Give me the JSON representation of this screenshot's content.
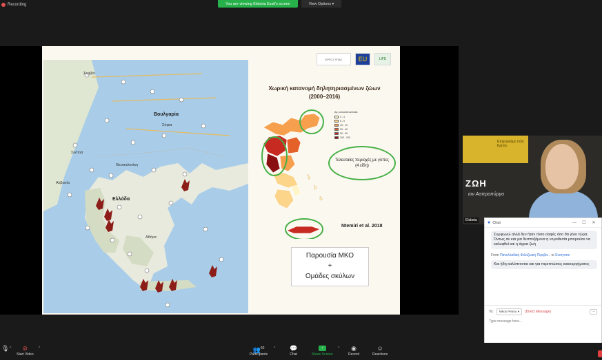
{
  "topbar": {
    "recording": "Recording",
    "viewing": "You are viewing Elsbeta Ezsit's screen",
    "view_options": "View Options"
  },
  "slide": {
    "map_labels": {
      "serbia": "Σερβία",
      "bulgaria": "Βουλγαρία",
      "greece": "Ελλάδα",
      "skopje": "Σκόπια",
      "sofia": "Σόφια",
      "albania": "Αλβανία",
      "athens": "Αθήνα",
      "thessaloniki": "Θεσσαλονίκη"
    },
    "map_footer": "",
    "title_line1": "Χωρική κατανομή δηλητηριασμένων ζώων",
    "title_line2": "(2000–2016)",
    "legend_title": "Αρ. poisoned animals",
    "legend": [
      {
        "label": "0 - 4",
        "color": "#fff5c8"
      },
      {
        "label": "5 - 9",
        "color": "#fcd48a"
      },
      {
        "label": "10 - 19",
        "color": "#f6a04e"
      },
      {
        "label": "20 - 49",
        "color": "#e4612a"
      },
      {
        "label": "50 - 99",
        "color": "#c62a20"
      },
      {
        "label": "100 - 200",
        "color": "#8a0f12"
      }
    ],
    "oval_note": "Τελευταίες περιοχές με γύπες (4 είδη)",
    "citation": "Ntemiri et al. 2018",
    "ngo_line1": "Παρουσία ΜΚΟ",
    "ngo_line2": "+",
    "ngo_line3": "Ομάδες σκύλων",
    "logos": [
      "ΕΡΓΟ ΓΥΠΑΣ",
      "EU",
      "LIFE"
    ]
  },
  "video": {
    "sign": "Επιχειρούμε πάλι Κρήτη",
    "overlay_text": "ΖΩΗ",
    "overlay_sub": "ιον Ασπροπύργο",
    "name": "Elsbeta"
  },
  "chat": {
    "title": "Chat",
    "message1": "Συμφωνώ αλλά δεν ήταν τόσο σαφές όσο θα γίνει τώρα. Όντως αν και για δεσποζόμενα η νομοθεσία μπορούσε να καλυφθεί και η άγρια ζωή",
    "from_prefix": "From",
    "from_name": "Πανελλαδική Φιλοζωική Περιβα...",
    "from_to": "to",
    "from_target": "Everyone",
    "message2": "Και ήδη καλύπτονται και για περιπτώσεις κακουργήματος",
    "to_label": "To:",
    "recipient": "Nikos Petrou",
    "dm_label": "(Direct Message)",
    "input_placeholder": "Type message here..."
  },
  "toolbar": {
    "start_video": "Start Video",
    "participants": "Participants",
    "participant_count": "60",
    "chat": "Chat",
    "share_screen": "Share Screen",
    "record": "Record",
    "reactions": "Reactions"
  },
  "colors": {
    "zoom_green": "#26b14a",
    "vulture_red": "#8c1d18",
    "highlight_green": "#46b046"
  }
}
